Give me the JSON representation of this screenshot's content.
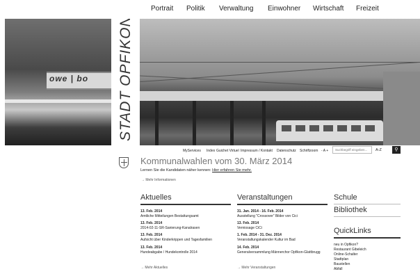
{
  "nav": [
    "Portrait",
    "Politik",
    "Verwaltung",
    "Einwohner",
    "Wirtschaft",
    "Freizeit"
  ],
  "brand": "STADT OPFIKON",
  "photo_sign": "owe | bo",
  "utility_links": [
    "MyServices",
    "Index",
    "Guichet Virtuel",
    "Impressum / Kontakt",
    "Datenschutz",
    "Schriftzoom"
  ],
  "font_zoom": "- A +",
  "search_placeholder": "Suchbegriff eingeben...",
  "az_label": "A-Z",
  "headline": "Kommunalwahlen vom 30. März 2014",
  "subline": "Lernen Sie die Kandidaten näher kennen:",
  "subline_link": "Hier erfahren Sie mehr.",
  "more_info": "Mehr Informationen",
  "aktuelles": {
    "title": "Aktuelles",
    "items": [
      {
        "date": "13. Feb. 2014",
        "text": "Amtliche Mitteilungen Bestattungsamt"
      },
      {
        "date": "13. Feb. 2014",
        "text": "2014-02-11-SR-Sanierung-Kanalrasen"
      },
      {
        "date": "13. Feb. 2014",
        "text": "Aufsicht über Kinderkrippen und Tagesfamilien"
      },
      {
        "date": "13. Feb. 2014",
        "text": "Hundeabgabe / Hundekontrolle 2014"
      }
    ],
    "more": "Mehr Aktuelles"
  },
  "veranstaltungen": {
    "title": "Veranstaltungen",
    "items": [
      {
        "date": "31. Jan. 2014 - 16. Feb. 2014",
        "text": "Ausstellung \"Crossover\" Bilder von Cici"
      },
      {
        "date": "13. Feb. 2014",
        "text": "Verniosage CiCi"
      },
      {
        "date": "1. Feb. 2014 - 31. Dez. 2014",
        "text": "Veranstaltungskalender Kultur im Bad"
      },
      {
        "date": "14. Feb. 2014",
        "text": "Generalversammlung Männerchor Opfikon-Glattbrugg"
      }
    ],
    "more": "Mehr Veranstaltungen"
  },
  "schule": "Schule",
  "bibliothek": "Bibliothek",
  "quicklinks": {
    "title": "QuickLinks",
    "items": [
      "neu in Opfikon?",
      "Restaurant Gibeleich",
      "Online-Schalter",
      "Stadtplan",
      "Baustellen",
      "Abfall"
    ]
  }
}
